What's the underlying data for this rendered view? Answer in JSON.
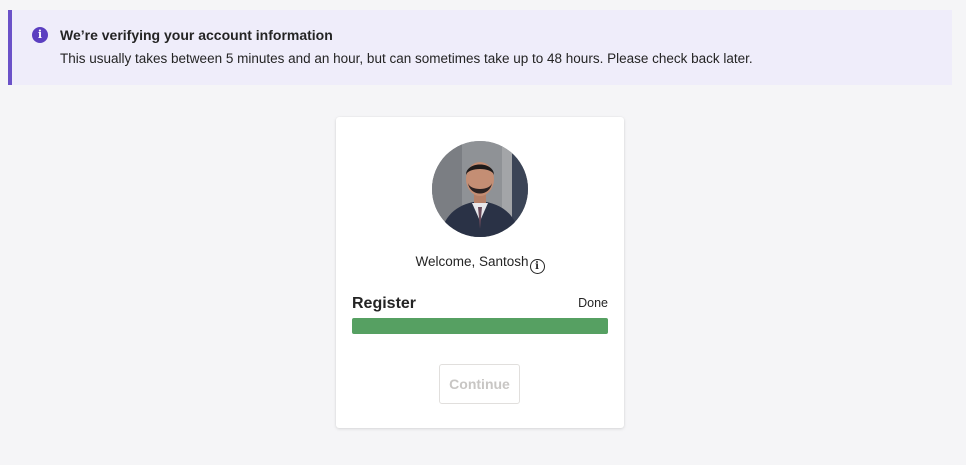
{
  "banner": {
    "icon": "info-icon",
    "icon_glyph": "i",
    "title": "We’re verifying your account information",
    "message": "This usually takes between 5 minutes and an hour, but can sometimes take up to 48 hours. Please check back later."
  },
  "card": {
    "welcome_text": "Welcome, Santosh",
    "info_glyph": "i",
    "step": {
      "label": "Register",
      "status": "Done",
      "progress": 1.0
    },
    "continue_label": "Continue"
  },
  "colors": {
    "banner_accent": "#6b52c8",
    "banner_background": "#efedfa",
    "progress_fill": "#56a062",
    "disabled_text": "#c8c6c4"
  }
}
